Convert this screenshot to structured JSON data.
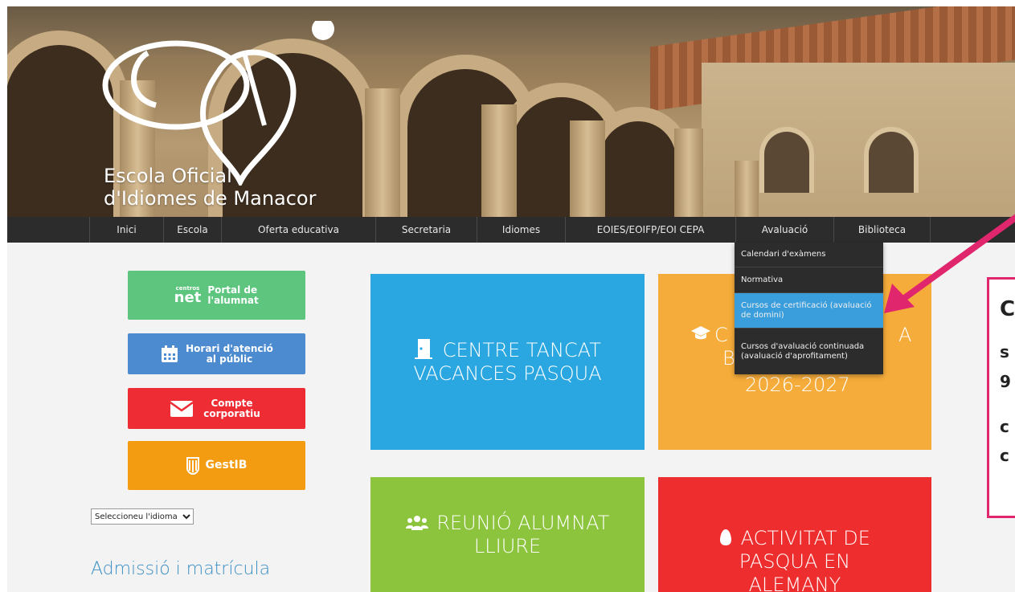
{
  "site": {
    "logo_line1": "Escola Oficial",
    "logo_line2": "d'Idiomes de Manacor"
  },
  "nav": {
    "items": [
      {
        "label": "Inici"
      },
      {
        "label": "Escola"
      },
      {
        "label": "Oferta educativa"
      },
      {
        "label": "Secretaria"
      },
      {
        "label": "Idiomes"
      },
      {
        "label": "EOIES/EOIFP/EOI CEPA"
      },
      {
        "label": "Avaluació"
      },
      {
        "label": "Biblioteca"
      }
    ]
  },
  "dropdown": {
    "items": [
      {
        "label": "Calendari d'exàmens"
      },
      {
        "label": "Normativa"
      },
      {
        "label": "Cursos de certificació (avaluació de domini)"
      },
      {
        "label": "Cursos d'avaluació continuada (avaluació d'aprofitament)"
      }
    ],
    "active_index": 2
  },
  "sidebar": {
    "centros_small": "centros",
    "centros_big": "net",
    "portal_label": "Portal de l'alumnat",
    "horari_label": "Horari d'atenció al públic",
    "compte_label": "Compte corporatiu",
    "gestib_label": "GestIB",
    "language_select": "Seleccioneu l'idioma",
    "admission_heading": "Admissió i matrícula"
  },
  "tiles": {
    "closed": "CENTRE TANCAT VACANCES PASQUA",
    "offer_left": "C",
    "offer_right": "A",
    "offer_mid": "B",
    "offer_year": "2026-2027",
    "meeting": "REUNIÓ ALUMNAT LLIURE",
    "activity": "ACTIVITAT DE PASQUA EN ALEMANY"
  },
  "callout": {
    "lines": [
      "C",
      "s",
      "9",
      "c",
      "c"
    ]
  },
  "colors": {
    "nav_bg": "#2c2c2c",
    "dropdown_active": "#3a9ddc",
    "tile_blue": "#2aa6e0",
    "tile_orange": "#f6ac3a",
    "tile_green": "#8cc43d",
    "tile_red": "#ee2e2e",
    "btn_green": "#5ec57e",
    "btn_blue": "#4c8bd0",
    "btn_red": "#ee2c34",
    "btn_orange": "#f39c12",
    "accent_pink": "#e0266d"
  }
}
